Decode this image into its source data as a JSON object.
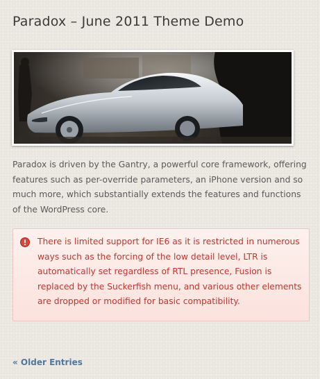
{
  "post": {
    "title": "Paradox – June 2011 Theme Demo",
    "image_alt": "Silver sports car at an auto show",
    "body": "Paradox is driven by the Gantry, a powerful core framework, offering features such as per-override parameters, an iPhone version and so much more, which substantially extends the features and functions of the WordPress core."
  },
  "notice": {
    "icon": "alert-circle-icon",
    "text": "There is limited support for IE6 as it is restricted in numerous ways such as the forcing of the low detail level, LTR is automatically set regardless of RTL presence, Fusion is replaced by the Suckerfish menu, and various other elements are dropped or modified for basic compatibility."
  },
  "pagination": {
    "older_entries": "« Older Entries"
  },
  "colors": {
    "background": "#ece8e2",
    "title": "#3a3a3a",
    "body_text": "#5a5a5a",
    "notice_text": "#c1352d",
    "notice_border": "#f0c4c0",
    "notice_background": "#fbe2dd",
    "link": "#52779c"
  }
}
